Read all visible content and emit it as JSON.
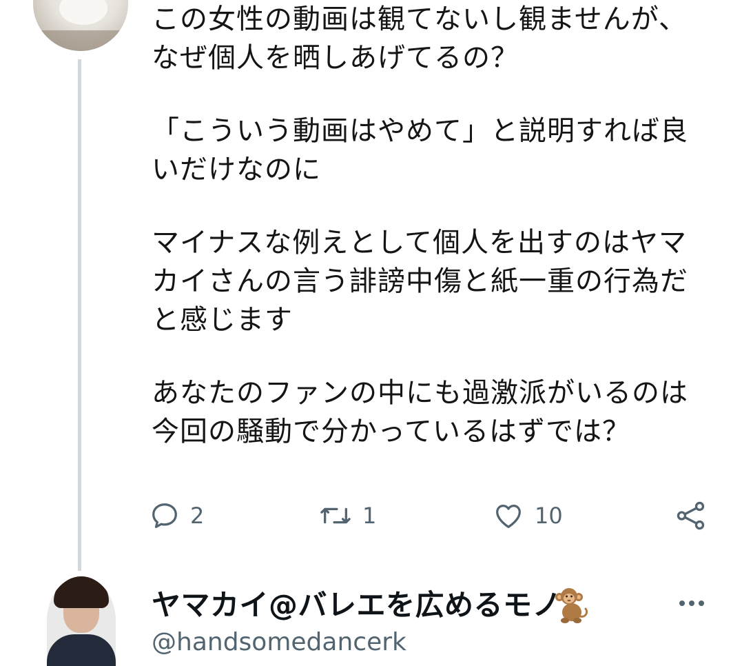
{
  "tweet": {
    "paragraphs": [
      [
        "この女性の動画は観てないし観ませんが、",
        "なぜ個人を晒しあげてるの？"
      ],
      [
        "「こういう動画はやめて」と説明すれば良",
        "いだけなのに"
      ],
      [
        "マイナスな例えとして個人を出すのはヤマ",
        "カイさんの言う誹謗中傷と紙一重の行為だ",
        "と感じます"
      ],
      [
        "あなたのファンの中にも過激派がいるのは",
        "今回の騒動で分かっているはずでは？"
      ]
    ],
    "actions": {
      "reply_count": "2",
      "retweet_count": "1",
      "like_count": "10"
    },
    "icons": [
      "reply-icon",
      "retweet-icon",
      "like-icon",
      "share-icon"
    ]
  },
  "next_tweet": {
    "display_name": "ヤマカイ@バレエを広めるモノ",
    "name_emoji_icon": "monkey-icon",
    "handle": "@handsomedancerk",
    "more_icon": "more-icon"
  },
  "colors": {
    "text": "#151515",
    "secondary": "#536471",
    "thread_line": "#cfd9de"
  }
}
